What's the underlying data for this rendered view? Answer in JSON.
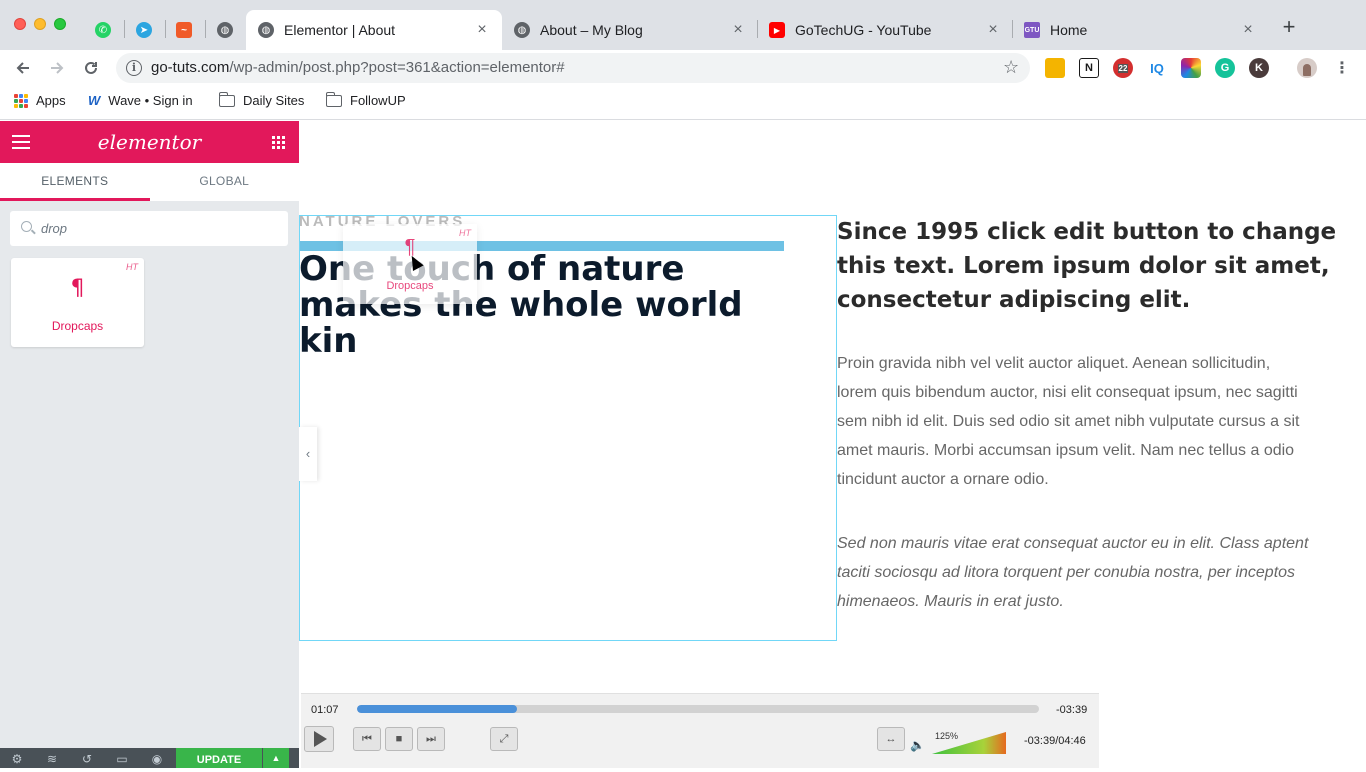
{
  "browser": {
    "pinned_tabs": [
      {
        "icon": "whatsapp-icon",
        "color": "#25d366"
      },
      {
        "icon": "telegram-icon",
        "color": "#2ca5e0"
      },
      {
        "icon": "analytics-icon",
        "color": "#f05a28"
      },
      {
        "icon": "globe-icon",
        "color": "#5f6368"
      }
    ],
    "tabs": [
      {
        "title": "Elementor | About",
        "icon": "globe-icon",
        "active": true
      },
      {
        "title": "About – My Blog",
        "icon": "globe-icon",
        "active": false
      },
      {
        "title": "GoTechUG - YouTube",
        "icon": "youtube-icon",
        "active": false
      },
      {
        "title": "Home",
        "icon": "gtu-icon",
        "active": false
      }
    ],
    "close_glyph": "×",
    "new_tab_glyph": "+",
    "url_host": "go-tuts.com",
    "url_rest": "/wp-admin/post.php?post=361&action=elementor#",
    "extensions": [
      {
        "icon": "notes-extension-icon",
        "color": "#f4b400",
        "label": ""
      },
      {
        "icon": "n-extension-icon",
        "color": "#1a1a1a",
        "label": "N"
      },
      {
        "icon": "abp-extension-icon",
        "color": "#d32f2f",
        "label": "22"
      },
      {
        "icon": "iq-extension-icon",
        "color": "#1e88e5",
        "label": "IQ"
      },
      {
        "icon": "color-extension-icon",
        "color": "#8e24aa",
        "label": ""
      },
      {
        "icon": "grammarly-extension-icon",
        "color": "#15c39a",
        "label": "G"
      },
      {
        "icon": "k-extension-icon",
        "color": "#4a3b3b",
        "label": "K"
      },
      {
        "icon": "profile-avatar-icon",
        "color": "#8d6e63",
        "label": ""
      }
    ],
    "bookmarks": [
      {
        "label": "Apps",
        "icon": "apps-grid-icon"
      },
      {
        "label": "Wave • Sign in",
        "icon": "wave-icon"
      },
      {
        "label": "Daily Sites",
        "icon": "folder-icon"
      },
      {
        "label": "FollowUP",
        "icon": "folder-icon"
      }
    ]
  },
  "elementor": {
    "logo": "elementor",
    "tabs": [
      "ELEMENTS",
      "GLOBAL"
    ],
    "active_tab": "ELEMENTS",
    "search_value": "drop",
    "widget": {
      "label": "Dropcaps",
      "badge": "HT",
      "glyph": "¶"
    },
    "footer": {
      "update_label": "UPDATE",
      "update_arrow": "▲"
    },
    "brand_color": "#e2185b"
  },
  "canvas": {
    "kicker": "NATURE LOVERS",
    "hero_title": "One touch of nature makes the whole world kin",
    "drag_ghost": {
      "label": "Dropcaps",
      "badge": "HT",
      "glyph": "¶"
    },
    "collapse_glyph": "‹",
    "right_heading": "Since 1995 click edit button to change this text. Lorem ipsum dolor sit amet, consectetur adipiscing elit.",
    "right_paragraph_lines": [
      "Proin gravida nibh vel velit auctor aliquet. Aenean sollicitudin,",
      "lorem quis bibendum auctor, nisi elit consequat ipsum, nec sagitti",
      "sem nibh id elit. Duis sed odio sit amet nibh vulputate cursus a sit",
      "amet mauris. Morbi accumsan ipsum velit. Nam nec tellus a odio",
      "tincidunt auctor a ornare odio."
    ],
    "right_italic_lines": [
      "Sed non mauris vitae erat consequat auctor eu in elit. Class aptent",
      "taciti sociosqu ad litora torquent per conubia nostra, per inceptos",
      "himenaeos. Mauris in erat justo."
    ]
  },
  "player": {
    "elapsed": "01:07",
    "remaining": "-03:39",
    "progress": 0.235,
    "volume_percent": "125%",
    "time_total": "-03:39/04:46",
    "controls": {
      "prev": "⏮",
      "stop": "■",
      "next": "⏭",
      "fullscreen": "⤢",
      "stretch": "↔",
      "speaker": "🔈"
    }
  }
}
